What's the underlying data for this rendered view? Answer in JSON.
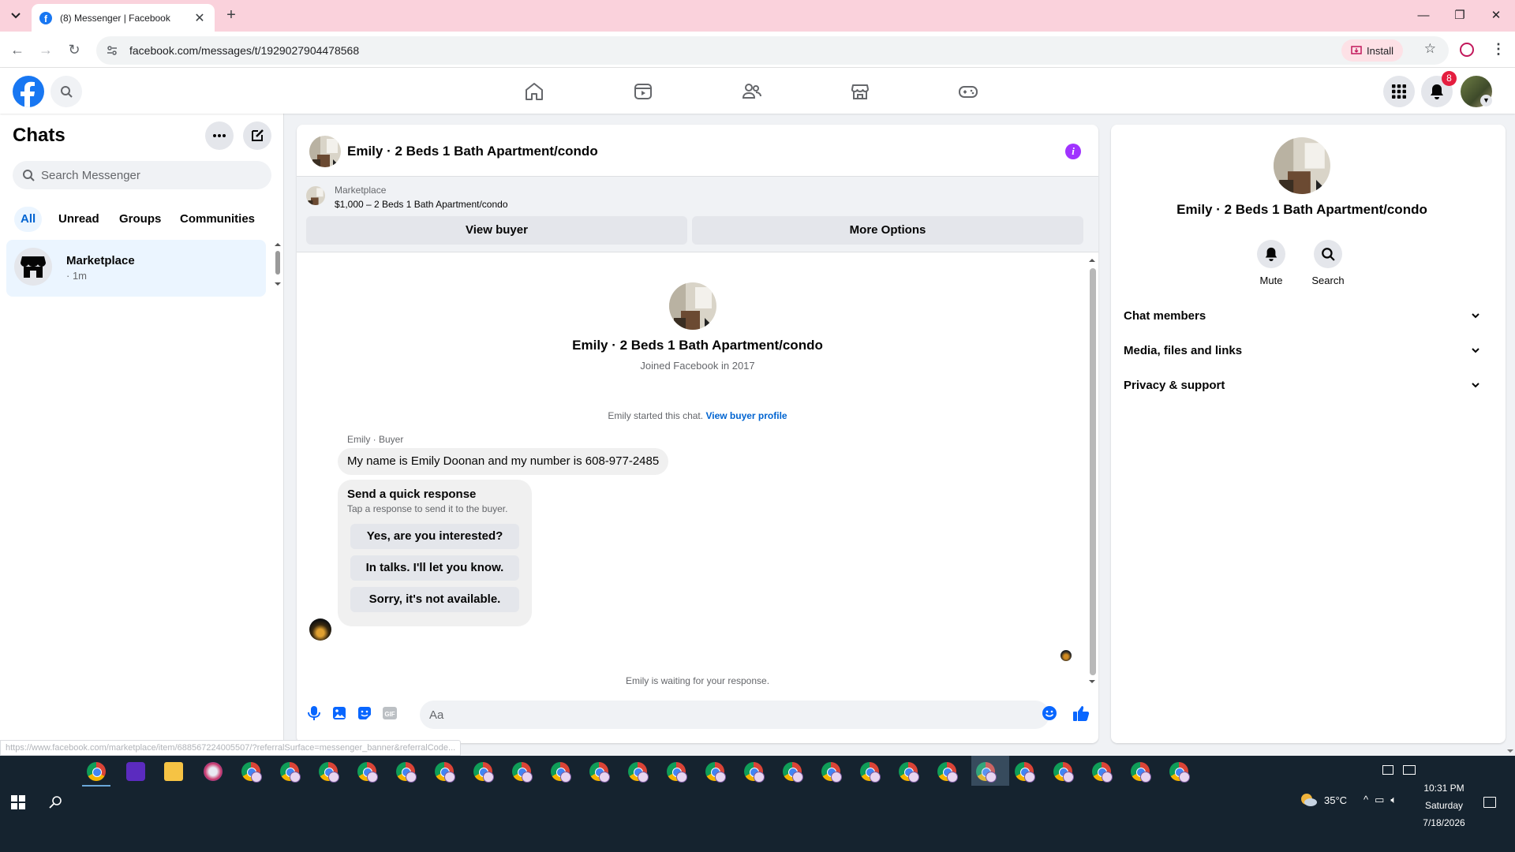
{
  "browser": {
    "tab_title": "(8) Messenger | Facebook",
    "url": "facebook.com/messages/t/1929027904478568",
    "install_label": "Install",
    "status_url": "https://www.facebook.com/marketplace/item/688567224005507/?referralSurface=messenger_banner&referralCode...",
    "accent_color": "#fad2dc"
  },
  "header": {
    "notification_count": "8",
    "nav_icons": [
      "home-icon",
      "video-icon",
      "friends-icon",
      "marketplace-icon",
      "gaming-icon"
    ]
  },
  "sidebar": {
    "title": "Chats",
    "search_placeholder": "Search Messenger",
    "filters": [
      "All",
      "Unread",
      "Groups",
      "Communities"
    ],
    "active_filter": "All",
    "chats": [
      {
        "name": "Marketplace",
        "meta": "· 1m"
      }
    ]
  },
  "conversation": {
    "title": "Emily · 2 Beds 1 Bath Apartment/condo",
    "banner": {
      "label": "Marketplace",
      "listing": "$1,000 – 2 Beds 1 Bath Apartment/condo",
      "view_buyer": "View buyer",
      "more_options": "More Options"
    },
    "profile": {
      "name": "Emily · 2 Beds 1 Bath Apartment/condo",
      "joined": "Joined Facebook in 2017"
    },
    "started_text": "Emily started this chat.",
    "view_buyer_profile": "View buyer profile",
    "sender_label": "Emily · Buyer",
    "message": "My name is Emily Doonan and my number is 608-977-2485",
    "quick_response": {
      "title": "Send a quick response",
      "subtitle": "Tap a response to send it to the buyer.",
      "options": [
        "Yes, are you interested?",
        "In talks. I'll let you know.",
        "Sorry, it's not available."
      ]
    },
    "waiting": "Emily is waiting for your response.",
    "composer_placeholder": "Aa"
  },
  "info_panel": {
    "name": "Emily · 2 Beds 1 Bath Apartment/condo",
    "actions": [
      {
        "label": "Mute",
        "icon": "bell-icon"
      },
      {
        "label": "Search",
        "icon": "search-icon"
      }
    ],
    "sections": [
      "Chat members",
      "Media, files and links",
      "Privacy & support"
    ]
  },
  "taskbar": {
    "temperature": "35°C",
    "time": "10:31 PM",
    "day": "Saturday",
    "date": "7/18/2026"
  }
}
